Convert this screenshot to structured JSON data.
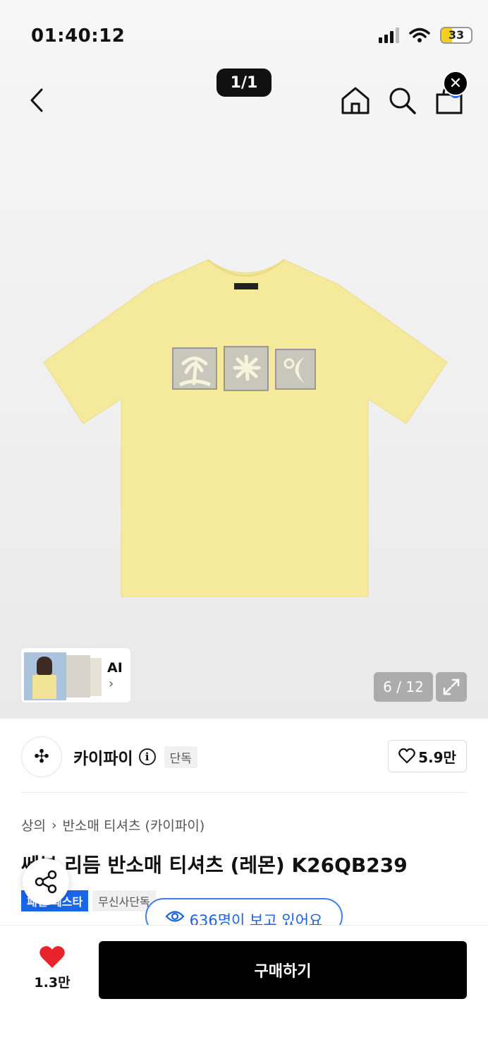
{
  "status_bar": {
    "time": "01:40:12",
    "battery_level": "33"
  },
  "header": {
    "page_indicator": "1/1"
  },
  "gallery": {
    "counter": "6 / 12",
    "ai_label": "AI",
    "ai_chevron": "›"
  },
  "brand": {
    "name": "카이파이",
    "info": "i",
    "tag": "단독",
    "likes": "5.9만"
  },
  "product": {
    "breadcrumb": [
      "상의",
      "반소매 티셔츠 (카이파이)"
    ],
    "breadcrumb_sep": "›",
    "title": "쎄븐 리듬 반소매 티셔츠 (레몬) K26QB239",
    "tags": [
      "패션 페스타",
      "무신사단독"
    ]
  },
  "viewer_badge": {
    "text": "636명이 보고 있어요"
  },
  "bottom_bar": {
    "wish_count": "1.3만",
    "buy_label": "구매하기"
  },
  "colors": {
    "accent_blue": "#1966e8",
    "heart_red": "#e8232b",
    "shirt_yellow": "#f5ea9c",
    "black": "#000000"
  },
  "icons": [
    "back-icon",
    "home-icon",
    "search-icon",
    "cart-icon",
    "close-icon",
    "expand-icon",
    "info-icon",
    "heart-outline-icon",
    "share-icon",
    "eye-icon",
    "heart-filled-icon"
  ]
}
